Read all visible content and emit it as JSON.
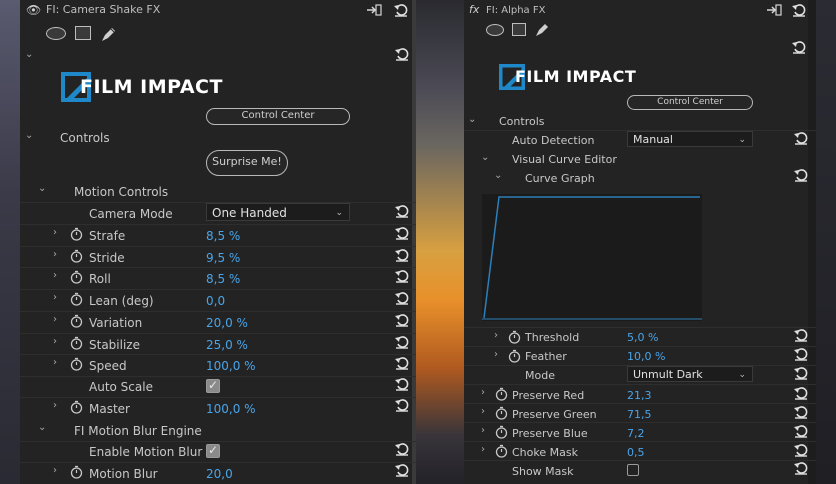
{
  "left_panel": {
    "title": "FI: Camera Shake FX",
    "logo_text": "FILM IMPACT",
    "control_center": "Control Center",
    "controls_label": "Controls",
    "surprise": "Surprise Me!",
    "motion_controls": "Motion Controls",
    "camera_mode_label": "Camera Mode",
    "camera_mode_value": "One Handed",
    "params": [
      {
        "label": "Strafe",
        "value": "8,5 %"
      },
      {
        "label": "Stride",
        "value": "9,5 %"
      },
      {
        "label": "Roll",
        "value": "8,5 %"
      },
      {
        "label": "Lean (deg)",
        "value": "0,0"
      },
      {
        "label": "Variation",
        "value": "20,0 %"
      },
      {
        "label": "Stabilize",
        "value": "25,0 %"
      },
      {
        "label": "Speed",
        "value": "100,0 %"
      }
    ],
    "auto_scale": "Auto Scale",
    "master_label": "Master",
    "master_value": "100,0 %",
    "blur_engine": "FI Motion Blur Engine",
    "enable_blur": "Enable Motion Blur",
    "motion_blur_label": "Motion Blur",
    "motion_blur_value": "20,0"
  },
  "right_panel": {
    "fx_badge": "fx",
    "title": "FI: Alpha FX",
    "logo_text": "FILM IMPACT",
    "control_center": "Control Center",
    "controls_label": "Controls",
    "auto_detection_label": "Auto Detection",
    "auto_detection_value": "Manual",
    "visual_curve_editor": "Visual Curve Editor",
    "curve_graph": "Curve Graph",
    "threshold_label": "Threshold",
    "threshold_value": "5,0 %",
    "feather_label": "Feather",
    "feather_value": "10,0 %",
    "mode_label": "Mode",
    "mode_value": "Unmult Dark",
    "params": [
      {
        "label": "Preserve Red",
        "value": "21,3"
      },
      {
        "label": "Preserve Green",
        "value": "71,5"
      },
      {
        "label": "Preserve Blue",
        "value": "7,2"
      },
      {
        "label": "Choke Mask",
        "value": "0,5"
      }
    ],
    "show_mask": "Show Mask"
  },
  "colors": {
    "accent_blue": "#4aa4e8",
    "panel_bg": "#232323",
    "logo_blue": "#1e88c8"
  }
}
